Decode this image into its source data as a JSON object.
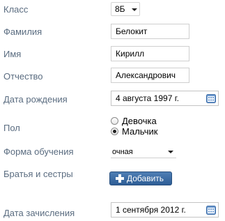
{
  "form": {
    "class": {
      "label": "Класс",
      "value": "8Б"
    },
    "last_name": {
      "label": "Фамилия",
      "value": "Белокит"
    },
    "first_name": {
      "label": "Имя",
      "value": "Кирилл"
    },
    "patronymic": {
      "label": "Отчество",
      "value": "Александрович"
    },
    "birth_date": {
      "label": "Дата рождения",
      "value": "4 августа 1997 г."
    },
    "gender": {
      "label": "Пол",
      "options": [
        {
          "label": "Девочка",
          "checked": false
        },
        {
          "label": "Мальчик",
          "checked": true
        }
      ]
    },
    "study_form": {
      "label": "Форма обучения",
      "value": "очная"
    },
    "siblings": {
      "label": "Братья и сестры",
      "add_button": "Добавить"
    },
    "enrollment_date": {
      "label": "Дата зачисления",
      "value": "1 сентября 2012 г."
    }
  },
  "icons": {
    "calendar": "calendar-icon",
    "dropdown": "chevron-down-icon",
    "add": "plus-icon"
  },
  "colors": {
    "label": "#5a6c80",
    "button": "#3a6aa5"
  }
}
